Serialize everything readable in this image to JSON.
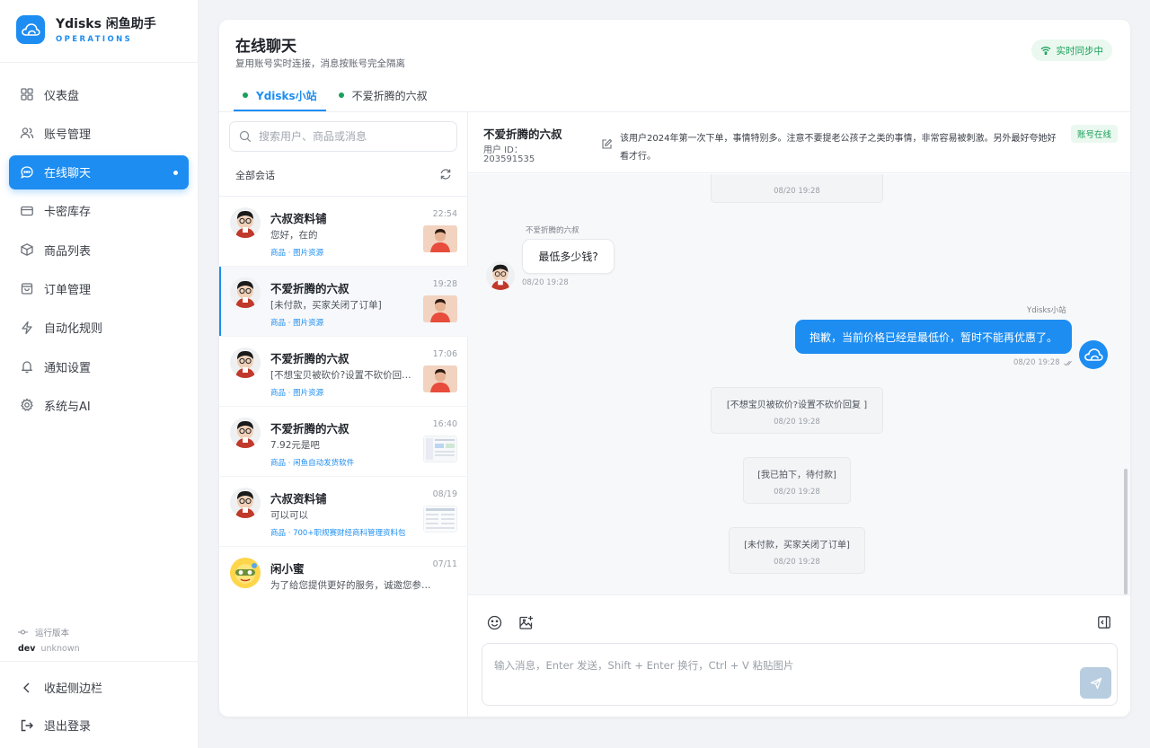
{
  "brand": {
    "name": "Ydisks 闲鱼助手",
    "sub": "OPERATIONS",
    "color": "#1d8df1"
  },
  "nav": [
    {
      "label": "仪表盘",
      "icon": "dashboard-icon"
    },
    {
      "label": "账号管理",
      "icon": "users-icon"
    },
    {
      "label": "在线聊天",
      "icon": "chat-icon",
      "active": true
    },
    {
      "label": "卡密库存",
      "icon": "card-icon"
    },
    {
      "label": "商品列表",
      "icon": "box-icon"
    },
    {
      "label": "订单管理",
      "icon": "bag-icon"
    },
    {
      "label": "自动化规则",
      "icon": "lightning-icon"
    },
    {
      "label": "通知设置",
      "icon": "bell-icon"
    },
    {
      "label": "系统与AI",
      "icon": "gear-icon"
    }
  ],
  "version": {
    "label": "运行版本",
    "env": "dev",
    "build": "unknown"
  },
  "bottom": {
    "collapse": "收起侧边栏",
    "logout": "退出登录"
  },
  "page": {
    "title": "在线聊天",
    "subtitle": "复用账号实时连接，消息按账号完全隔离",
    "sync": "实时同步中"
  },
  "tabs": [
    {
      "label": "Ydisks小站",
      "active": true
    },
    {
      "label": "不爱折腾的六叔",
      "active": false
    }
  ],
  "search": {
    "placeholder": "搜索用户、商品或消息",
    "value": ""
  },
  "conversations_label": "全部会话",
  "conversations": [
    {
      "name": "六叔资料铺",
      "time": "22:54",
      "msg": "您好，在的",
      "tag": "商品 · 图片资源",
      "avatar": "cartoon",
      "thumb": "person"
    },
    {
      "name": "不爱折腾的六叔",
      "time": "19:28",
      "msg": "[未付款，买家关闭了订单]",
      "tag": "商品 · 图片资源",
      "avatar": "cartoon",
      "thumb": "person",
      "active": true
    },
    {
      "name": "不爱折腾的六叔",
      "time": "17:06",
      "msg": "[不想宝贝被砍价?设置不砍价回复 ]",
      "tag": "商品 · 图片资源",
      "avatar": "cartoon",
      "thumb": "person"
    },
    {
      "name": "不爱折腾的六叔",
      "time": "16:40",
      "msg": "7.92元是吧",
      "tag": "商品 · 闲鱼自动发货软件",
      "avatar": "cartoon",
      "thumb": "screenshot"
    },
    {
      "name": "六叔资料铺",
      "time": "08/19",
      "msg": "可以可以",
      "tag": "商品 · 700+职规赛财经商科管理资料包",
      "avatar": "cartoon",
      "thumb": "screenshot"
    },
    {
      "name": "闲小蜜",
      "time": "07/11",
      "msg": "为了给您提供更好的服务，诚邀您参与调研",
      "tag": "",
      "avatar": "yellow",
      "thumb": ""
    }
  ],
  "chat": {
    "user": "不爱折腾的六叔",
    "uid_label": "用户 ID：",
    "uid": "203591535",
    "note": "该用户2024年第一次下单，事情特别多。注意不要提老公孩子之类的事情，非常容易被刺激。另外最好夸她好看才行。",
    "status": "账号在线"
  },
  "messages": {
    "top_time": "08/20 19:28",
    "in_sender": "不爱折腾的六叔",
    "in_text": "最低多少钱?",
    "in_time": "08/20 19:28",
    "out_sender": "Ydisks小站",
    "out_text": "抱歉，当前价格已经是最低价，暂时不能再优惠了。",
    "out_time": "08/20 19:28",
    "sys1_text": "[不想宝贝被砍价?设置不砍价回复 ]",
    "sys1_time": "08/20 19:28",
    "sys2_text": "[我已拍下，待付款]",
    "sys2_time": "08/20 19:28",
    "sys3_text": "[未付款，买家关闭了订单]",
    "sys3_time": "08/20 19:28"
  },
  "composer": {
    "placeholder": "输入消息，Enter 发送，Shift + Enter 换行，Ctrl + V 粘贴图片",
    "value": ""
  },
  "colors": {
    "accent": "#1d8df1",
    "online": "#1aa05a"
  }
}
